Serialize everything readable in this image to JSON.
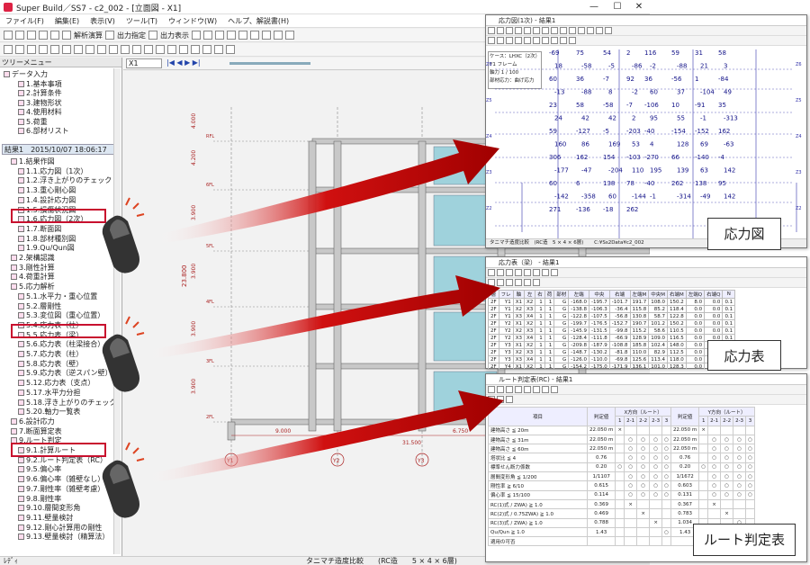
{
  "app": {
    "title": "Super Build／SS7 - c2_002 - [立面図 - X1]",
    "menu": [
      "ファイル(F)",
      "編集(E)",
      "表示(V)",
      "ツール(T)",
      "ウィンドウ(W)",
      "ヘルプ、解説書(H)"
    ],
    "toolbar1": {
      "calc_label": "解析演算",
      "output_settings": "出力指定",
      "output_view": "出力表示"
    },
    "frame_select": "X1",
    "tree_header": "ツリーメニュー",
    "status_left": "ﾚﾃﾞｨ",
    "status_right": "タニマチ造度比較　　(RC造　　5 × 4 × 6層)"
  },
  "tree": {
    "top_items": [
      {
        "label": "データ入力",
        "indent": 0
      },
      {
        "label": "1.基本事項",
        "indent": 2
      },
      {
        "label": "2.計算条件",
        "indent": 2
      },
      {
        "label": "3.建物形状",
        "indent": 2
      },
      {
        "label": "4.使用材料",
        "indent": 2
      },
      {
        "label": "5.荷重",
        "indent": 2
      },
      {
        "label": "6.部材リスト",
        "indent": 2
      }
    ],
    "result_label": "結果1　2015/10/07 18:06:17",
    "items": [
      {
        "label": "1.結果作図",
        "indent": 1
      },
      {
        "label": "1.1.応力図（1次）",
        "indent": 2
      },
      {
        "label": "1.2.浮き上がりのチェック",
        "indent": 2
      },
      {
        "label": "1.3.重心剛心図",
        "indent": 2
      },
      {
        "label": "1.4.設計応力図",
        "indent": 2
      },
      {
        "label": "1.5.損傷状況図",
        "indent": 2
      },
      {
        "label": "1.6.応力図（2次）",
        "indent": 2
      },
      {
        "label": "1.7.断面図",
        "indent": 2
      },
      {
        "label": "1.8.部材種別図",
        "indent": 2
      },
      {
        "label": "1.9.Qu/Qun図",
        "indent": 2
      },
      {
        "label": "2.架構認識",
        "indent": 1
      },
      {
        "label": "3.剛性計算",
        "indent": 1
      },
      {
        "label": "4.荷重計算",
        "indent": 1
      },
      {
        "label": "5.応力解析",
        "indent": 1
      },
      {
        "label": "5.1.水平力・重心位置",
        "indent": 2
      },
      {
        "label": "5.2.層剛性",
        "indent": 2
      },
      {
        "label": "5.3.変位図（重心位置）",
        "indent": 2
      },
      {
        "label": "5.4.応力表（柱）",
        "indent": 2
      },
      {
        "label": "5.5.応力表（梁）",
        "indent": 2
      },
      {
        "label": "5.6.応力表（柱梁接合）",
        "indent": 2
      },
      {
        "label": "5.7.応力表（柱）",
        "indent": 2
      },
      {
        "label": "5.8.応力表（壁）",
        "indent": 2
      },
      {
        "label": "5.9.応力表（逆スパン壁）",
        "indent": 2
      },
      {
        "label": "5.12.応力表（支点）",
        "indent": 2
      },
      {
        "label": "5.17.水平力分担",
        "indent": 2
      },
      {
        "label": "5.18.浮き上がりのチェック",
        "indent": 2
      },
      {
        "label": "5.20.軸力一覧表",
        "indent": 2
      },
      {
        "label": "6.設計応力",
        "indent": 1
      },
      {
        "label": "7.断面算定表",
        "indent": 1
      },
      {
        "label": "9.ルート判定",
        "indent": 1
      },
      {
        "label": "9.1.計算ルート",
        "indent": 2
      },
      {
        "label": "9.2.ルート判定表（RC）",
        "indent": 2
      },
      {
        "label": "9.5.偏心率",
        "indent": 2
      },
      {
        "label": "9.6.偏心率（雑壁なし）",
        "indent": 2
      },
      {
        "label": "9.7.剛性率（雑壁考慮）",
        "indent": 2
      },
      {
        "label": "9.8.剛性率",
        "indent": 2
      },
      {
        "label": "9.10.層間変形角",
        "indent": 2
      },
      {
        "label": "9.11.壁量検討",
        "indent": 2
      },
      {
        "label": "9.12.剛心計算用の剛性",
        "indent": 2
      },
      {
        "label": "9.13.壁量検討（精算法）",
        "indent": 2
      }
    ]
  },
  "elevation": {
    "story_labels": [
      "3.900",
      "3.900",
      "3.900",
      "3.900",
      "4.200",
      "4.000"
    ],
    "span_labels": [
      "9.000",
      "6.750",
      "6.750"
    ],
    "total_span": "31.500",
    "total_height": "23.800",
    "axes": [
      "Y1",
      "Y2",
      "Y3"
    ],
    "floor_labels": [
      "2FL",
      "3FL",
      "4FL",
      "5FL",
      "6FL",
      "RFL"
    ]
  },
  "stress_diagram": {
    "title": "応力図(1次) - 結果1",
    "info": [
      "ケース：LHXC（2次）",
      "Y1 フレーム",
      "軸力 1 / 100",
      "部材応力：曲げ応力"
    ],
    "path": "C:¥Ss2Data¥c2_002",
    "status": "タニマチ造度比較　(RC造　5 × 4 × 6層)",
    "numbers": [
      "-69",
      "75",
      "54",
      "2",
      "116",
      "59",
      "31",
      "58",
      "18",
      "-58",
      "-5",
      "-86",
      "-2",
      "-88",
      "21",
      "3",
      "60",
      "36",
      "-7",
      "92",
      "36",
      "-56",
      "1",
      "-84",
      "-13",
      "-88",
      "8",
      "-2",
      "60",
      "37",
      "-104",
      "49",
      "23",
      "58",
      "-58",
      "-7",
      "-106",
      "10",
      "-91",
      "35",
      "24",
      "42",
      "42",
      "2",
      "95",
      "55",
      "-1",
      "-313",
      "59",
      "-127",
      "-5",
      "-203",
      "-40",
      "-154",
      "-152",
      "162",
      "160",
      "86",
      "169",
      "53",
      "4",
      "128",
      "69",
      "-63",
      "306",
      "162",
      "154",
      "-103",
      "-270",
      "66",
      "-140",
      "-4",
      "-177",
      "-47",
      "-204",
      "110",
      "195",
      "139",
      "63",
      "142",
      "60",
      "6",
      "138",
      "78",
      "-40",
      "262",
      "138",
      "95",
      "-142",
      "-358",
      "60",
      "-144",
      "-1",
      "-314",
      "-49",
      "142",
      "271",
      "-136",
      "-18",
      "262"
    ],
    "caption": "応力図"
  },
  "stress_table": {
    "title": "応力表（梁） - 結果1",
    "headers": [
      "層",
      "フレ",
      "軸",
      "左",
      "右",
      "荷",
      "部材",
      "左端",
      "中央",
      "右端",
      "左端M",
      "中央M",
      "右端M",
      "左端Q",
      "右端Q",
      "N"
    ],
    "rows": [
      [
        "2F",
        "Y1",
        "X1",
        "X2",
        "1",
        "1",
        "G",
        "-168.0",
        "-195.7",
        "-101.7",
        "191.7",
        "108.0",
        "150.2",
        "8.0",
        "0.0",
        "0.1"
      ],
      [
        "2F",
        "Y1",
        "X2",
        "X3",
        "1",
        "1",
        "G",
        "-138.8",
        "-106.3",
        "-36.4",
        "115.8",
        "85.2",
        "118.4",
        "0.0",
        "0.0",
        "0.1"
      ],
      [
        "2F",
        "Y1",
        "X3",
        "X4",
        "1",
        "1",
        "G",
        "-122.8",
        "-107.5",
        "-56.8",
        "130.8",
        "58.7",
        "122.8",
        "0.0",
        "0.0",
        "0.1"
      ],
      [
        "2F",
        "Y2",
        "X1",
        "X2",
        "1",
        "1",
        "G",
        "-199.7",
        "-176.5",
        "-152.7",
        "190.7",
        "101.2",
        "150.2",
        "0.0",
        "0.0",
        "0.1"
      ],
      [
        "2F",
        "Y2",
        "X2",
        "X3",
        "1",
        "1",
        "G",
        "-145.9",
        "-131.5",
        "-99.8",
        "115.2",
        "58.6",
        "110.5",
        "0.0",
        "0.0",
        "0.1"
      ],
      [
        "2F",
        "Y2",
        "X3",
        "X4",
        "1",
        "1",
        "G",
        "-128.4",
        "-111.8",
        "-66.9",
        "128.9",
        "109.0",
        "116.5",
        "0.0",
        "0.0",
        "0.1"
      ],
      [
        "2F",
        "Y3",
        "X1",
        "X2",
        "1",
        "1",
        "G",
        "-209.8",
        "-187.9",
        "-108.8",
        "185.8",
        "102.4",
        "148.0",
        "0.0",
        "0.0",
        "0.1"
      ],
      [
        "2F",
        "Y3",
        "X2",
        "X3",
        "1",
        "1",
        "G",
        "-148.7",
        "-130.2",
        "-81.8",
        "110.0",
        "82.9",
        "112.5",
        "0.0",
        "0.0",
        "0.1"
      ],
      [
        "2F",
        "Y3",
        "X3",
        "X4",
        "1",
        "1",
        "G",
        "-126.0",
        "-110.0",
        "-69.8",
        "125.6",
        "113.4",
        "118.0",
        "0.0",
        "0.0",
        "0.1"
      ],
      [
        "2F",
        "Y4",
        "X1",
        "X2",
        "1",
        "1",
        "G",
        "-154.2",
        "-175.0",
        "-171.9",
        "136.1",
        "101.0",
        "128.3",
        "0.0",
        "0.0",
        "0.1"
      ],
      [
        "2F",
        "Y4",
        "X2",
        "X3",
        "1",
        "1",
        "G",
        "-180.1",
        "-171.8",
        "-108.6",
        "175.4",
        "107.1",
        "165.1",
        "0.0",
        "0.0",
        "0.1"
      ]
    ],
    "caption": "応力表"
  },
  "route_table": {
    "title": "ルート判定表(RC) - 結果1",
    "header": {
      "item": "項目",
      "standard": "判定値",
      "x_dir": "X方向（ルート）",
      "y_dir": "Y方向（ルート）",
      "route": "ルート",
      "cols": [
        "1",
        "2-1",
        "2-2",
        "2-3",
        "3"
      ]
    },
    "rows": [
      [
        "建物高さ ≦ 20m",
        "22.050 m",
        "×",
        "",
        "",
        "",
        "",
        "22.050 m",
        "×",
        "",
        "",
        "",
        ""
      ],
      [
        "建物高さ ≦ 31m",
        "22.050 m",
        "",
        "○",
        "○",
        "○",
        "○",
        "22.050 m",
        "",
        "○",
        "○",
        "○",
        "○"
      ],
      [
        "建物高さ ≦ 60m",
        "22.050 m",
        "",
        "○",
        "○",
        "○",
        "○",
        "22.050 m",
        "",
        "○",
        "○",
        "○",
        "○"
      ],
      [
        "塔状比 ≦ 4",
        "0.76",
        "",
        "○",
        "○",
        "○",
        "○",
        "0.76",
        "",
        "○",
        "○",
        "○",
        "○"
      ],
      [
        "標準せん断力係数",
        "0.20",
        "○",
        "○",
        "○",
        "○",
        "○",
        "0.20",
        "○",
        "○",
        "○",
        "○",
        "○"
      ],
      [
        "層間変形角 ≦ 1/200",
        "1/1107",
        "",
        "○",
        "○",
        "○",
        "○",
        "1/1672",
        "",
        "○",
        "○",
        "○",
        "○"
      ],
      [
        "剛性率 ≧ 6/10",
        "0.615",
        "",
        "○",
        "○",
        "○",
        "○",
        "0.603",
        "",
        "○",
        "○",
        "○",
        "○"
      ],
      [
        "偏心率 ≦ 15/100",
        "0.114",
        "",
        "○",
        "○",
        "○",
        "○",
        "0.131",
        "",
        "○",
        "○",
        "○",
        "○"
      ],
      [
        "RC(1)式 / ZWA) ≧ 1.0",
        "0.369",
        "",
        "×",
        "",
        "",
        "",
        "0.367",
        "",
        "×",
        "",
        "",
        ""
      ],
      [
        "RC(2)式 / 0.75ZWA) ≧ 1.0",
        "0.469",
        "",
        "",
        "×",
        "",
        "",
        "0.783",
        "",
        "",
        "×",
        "",
        ""
      ],
      [
        "RC(3)式 / ZWA) ≧ 1.0",
        "0.788",
        "",
        "",
        "",
        "×",
        "",
        "1.034",
        "",
        "",
        "",
        "○",
        ""
      ],
      [
        "Qu/Qun ≧ 1.0",
        "1.43",
        "",
        "",
        "",
        "",
        "○",
        "1.43",
        "",
        "",
        "",
        "",
        "○"
      ],
      [
        "適用の可否",
        "",
        "",
        "",
        "",
        "",
        "",
        "",
        "",
        "",
        "",
        "",
        ""
      ]
    ],
    "caption": "ルート判定表"
  },
  "colors": {
    "accent": "#c8102e",
    "arrow": "#b00000",
    "beam": "#c8c8c8",
    "wall": "#9fd2dc"
  }
}
